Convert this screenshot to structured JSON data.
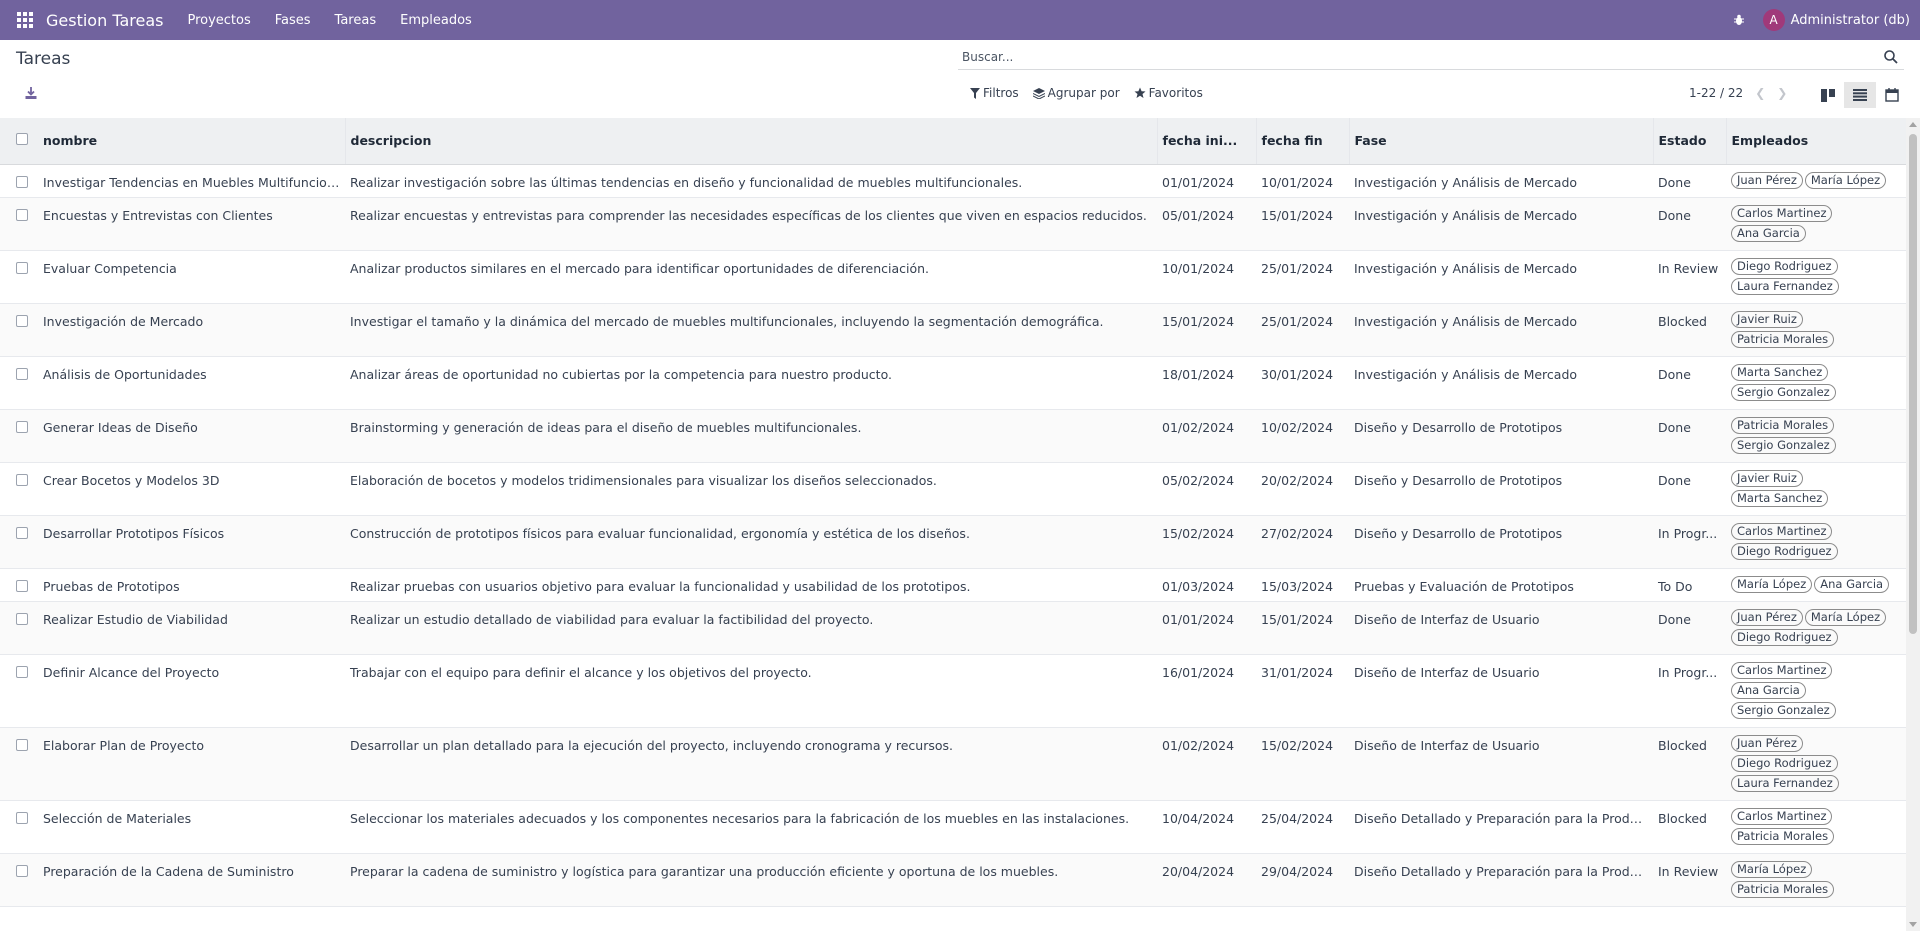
{
  "navbar": {
    "brand": "Gestion Tareas",
    "menu": [
      "Proyectos",
      "Fases",
      "Tareas",
      "Empleados"
    ],
    "avatar_letter": "A",
    "user": "Administrator (db)",
    "bg_color": "#71639e"
  },
  "control": {
    "title": "Tareas",
    "search_placeholder": "Buscar...",
    "filters_label": "Filtros",
    "groupby_label": "Agrupar por",
    "favorites_label": "Favoritos",
    "pager": "1-22 / 22"
  },
  "table": {
    "columns": [
      "nombre",
      "descripcion",
      "fecha ini...",
      "fecha fin",
      "Fase",
      "Estado",
      "Empleados"
    ],
    "rows": [
      {
        "nombre": "Investigar Tendencias en Muebles Multifuncionales",
        "descripcion": "Realizar investigación sobre las últimas tendencias en diseño y funcionalidad de muebles multifuncionales.",
        "inicio": "01/01/2024",
        "fin": "10/01/2024",
        "fase": "Investigación y Análisis de Mercado",
        "estado": "Done",
        "empleados": [
          "Juan Pérez",
          "María López"
        ]
      },
      {
        "nombre": "Encuestas y Entrevistas con Clientes",
        "descripcion": "Realizar encuestas y entrevistas para comprender las necesidades específicas de los clientes que viven en espacios reducidos.",
        "inicio": "05/01/2024",
        "fin": "15/01/2024",
        "fase": "Investigación y Análisis de Mercado",
        "estado": "Done",
        "empleados": [
          "Carlos Martinez",
          "Ana Garcia"
        ]
      },
      {
        "nombre": "Evaluar Competencia",
        "descripcion": "Analizar productos similares en el mercado para identificar oportunidades de diferenciación.",
        "inicio": "10/01/2024",
        "fin": "25/01/2024",
        "fase": "Investigación y Análisis de Mercado",
        "estado": "In Review",
        "empleados": [
          "Diego Rodriguez",
          "Laura Fernandez"
        ]
      },
      {
        "nombre": "Investigación de Mercado",
        "descripcion": "Investigar el tamaño y la dinámica del mercado de muebles multifuncionales, incluyendo la segmentación demográfica.",
        "inicio": "15/01/2024",
        "fin": "25/01/2024",
        "fase": "Investigación y Análisis de Mercado",
        "estado": "Blocked",
        "empleados": [
          "Javier Ruiz",
          "Patricia Morales"
        ]
      },
      {
        "nombre": "Análisis de Oportunidades",
        "descripcion": "Analizar áreas de oportunidad no cubiertas por la competencia para nuestro producto.",
        "inicio": "18/01/2024",
        "fin": "30/01/2024",
        "fase": "Investigación y Análisis de Mercado",
        "estado": "Done",
        "empleados": [
          "Marta Sanchez",
          "Sergio Gonzalez"
        ]
      },
      {
        "nombre": "Generar Ideas de Diseño",
        "descripcion": "Brainstorming y generación de ideas para el diseño de muebles multifuncionales.",
        "inicio": "01/02/2024",
        "fin": "10/02/2024",
        "fase": "Diseño y Desarrollo de Prototipos",
        "estado": "Done",
        "empleados": [
          "Patricia Morales",
          "Sergio Gonzalez"
        ]
      },
      {
        "nombre": "Crear Bocetos y Modelos 3D",
        "descripcion": "Elaboración de bocetos y modelos tridimensionales para visualizar los diseños seleccionados.",
        "inicio": "05/02/2024",
        "fin": "20/02/2024",
        "fase": "Diseño y Desarrollo de Prototipos",
        "estado": "Done",
        "empleados": [
          "Javier Ruiz",
          "Marta Sanchez"
        ]
      },
      {
        "nombre": "Desarrollar Prototipos Físicos",
        "descripcion": "Construcción de prototipos físicos para evaluar funcionalidad, ergonomía y estética de los diseños.",
        "inicio": "15/02/2024",
        "fin": "27/02/2024",
        "fase": "Diseño y Desarrollo de Prototipos",
        "estado": "In Progr...",
        "empleados": [
          "Carlos Martinez",
          "Diego Rodriguez"
        ]
      },
      {
        "nombre": "Pruebas de Prototipos",
        "descripcion": "Realizar pruebas con usuarios objetivo para evaluar la funcionalidad y usabilidad de los prototipos.",
        "inicio": "01/03/2024",
        "fin": "15/03/2024",
        "fase": "Pruebas y Evaluación de Prototipos",
        "estado": "To Do",
        "empleados": [
          "María López",
          "Ana Garcia"
        ]
      },
      {
        "nombre": "Realizar Estudio de Viabilidad",
        "descripcion": "Realizar un estudio detallado de viabilidad para evaluar la factibilidad del proyecto.",
        "inicio": "01/01/2024",
        "fin": "15/01/2024",
        "fase": "Diseño de Interfaz de Usuario",
        "estado": "Done",
        "empleados": [
          "Juan Pérez",
          "María López",
          "Diego Rodriguez"
        ]
      },
      {
        "nombre": "Definir Alcance del Proyecto",
        "descripcion": "Trabajar con el equipo para definir el alcance y los objetivos del proyecto.",
        "inicio": "16/01/2024",
        "fin": "31/01/2024",
        "fase": "Diseño de Interfaz de Usuario",
        "estado": "In Progr...",
        "empleados": [
          "Carlos Martinez",
          "Ana Garcia",
          "Sergio Gonzalez"
        ]
      },
      {
        "nombre": "Elaborar Plan de Proyecto",
        "descripcion": "Desarrollar un plan detallado para la ejecución del proyecto, incluyendo cronograma y recursos.",
        "inicio": "01/02/2024",
        "fin": "15/02/2024",
        "fase": "Diseño de Interfaz de Usuario",
        "estado": "Blocked",
        "empleados": [
          "Juan Pérez",
          "Diego Rodriguez",
          "Laura Fernandez"
        ]
      },
      {
        "nombre": "Selección de Materiales",
        "descripcion": "Seleccionar los materiales adecuados y los componentes necesarios para la fabricación de los muebles en las instalaciones.",
        "inicio": "10/04/2024",
        "fin": "25/04/2024",
        "fase": "Diseño Detallado y Preparación para la Producción",
        "estado": "Blocked",
        "empleados": [
          "Carlos Martinez",
          "Patricia Morales"
        ]
      },
      {
        "nombre": "Preparación de la Cadena de Suministro",
        "descripcion": "Preparar la cadena de suministro y logística para garantizar una producción eficiente y oportuna de los muebles.",
        "inicio": "20/04/2024",
        "fin": "29/04/2024",
        "fase": "Diseño Detallado y Preparación para la Producción",
        "estado": "In Review",
        "empleados": [
          "María López",
          "Patricia Morales"
        ]
      }
    ]
  }
}
